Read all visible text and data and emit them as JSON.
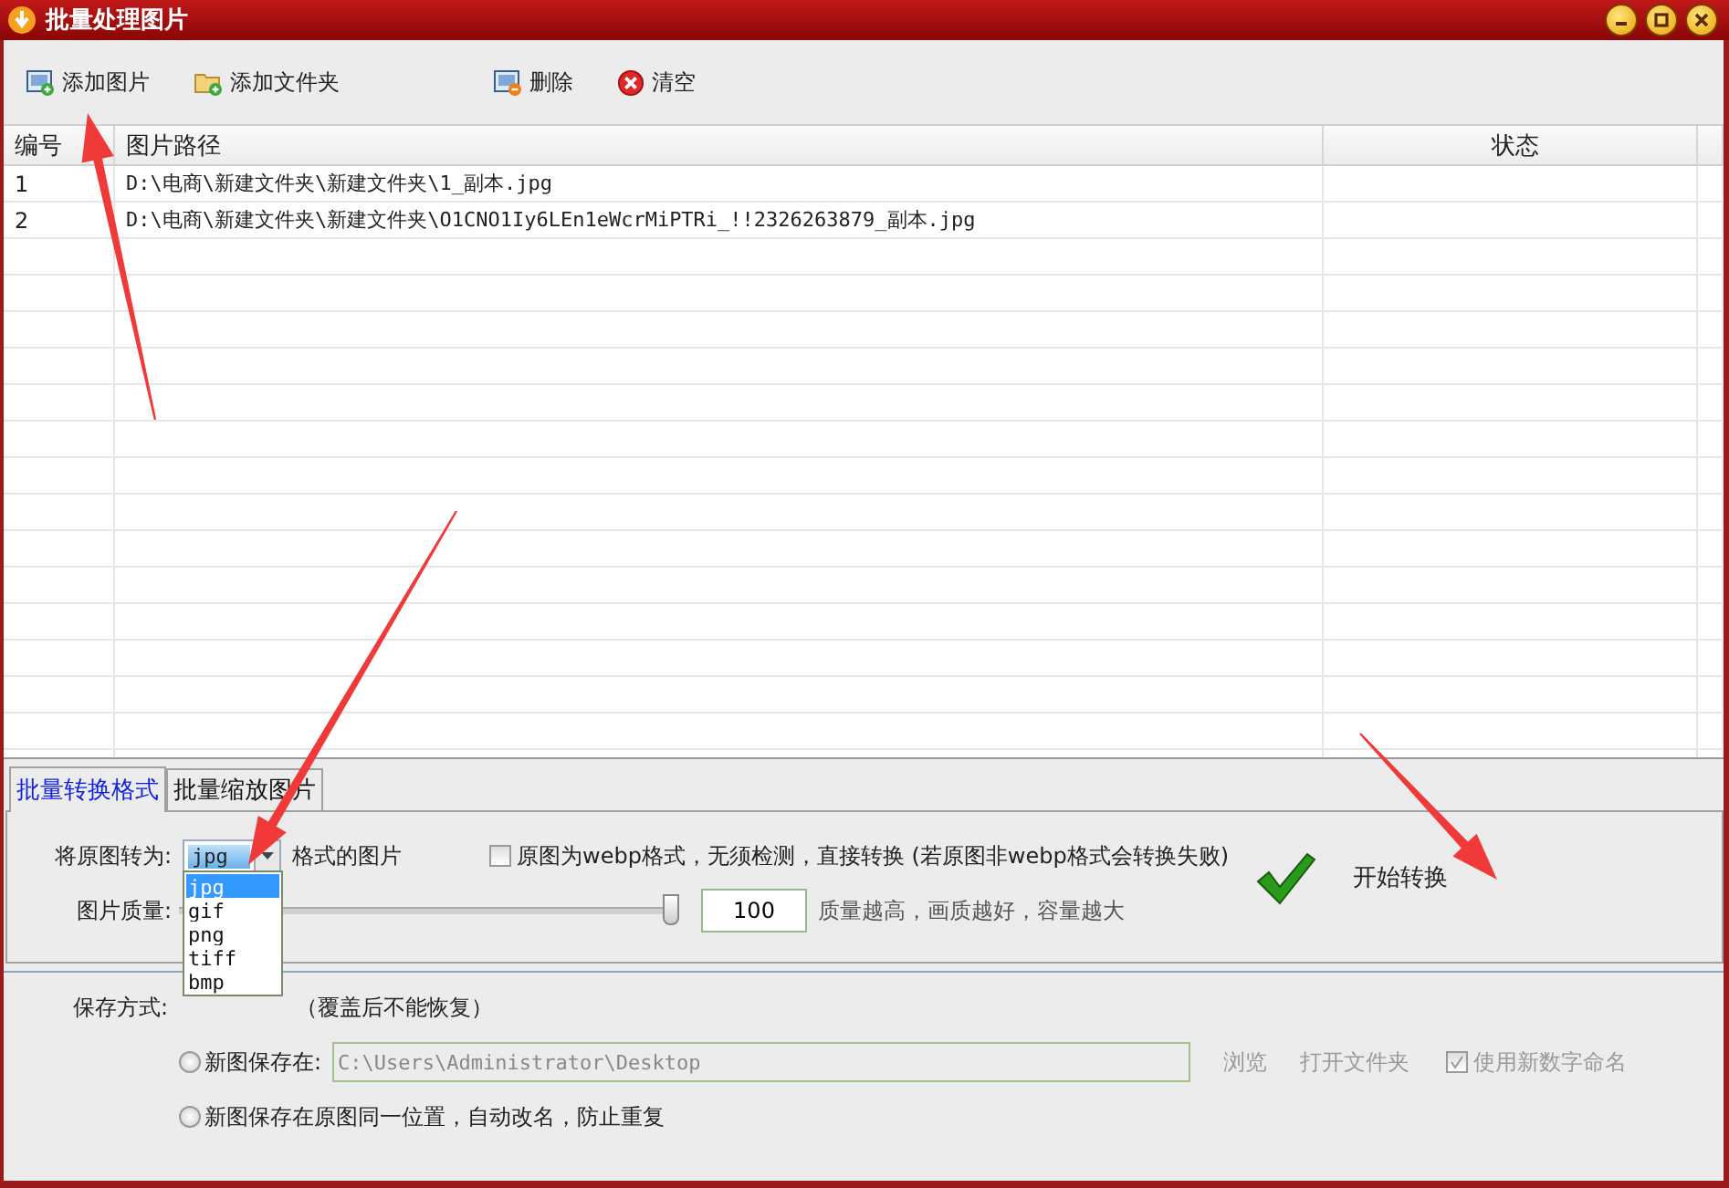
{
  "window": {
    "title": "批量处理图片"
  },
  "toolbar": [
    {
      "kind": "add-image",
      "label": "添加图片"
    },
    {
      "kind": "add-folder",
      "label": "添加文件夹"
    },
    {
      "kind": "delete",
      "label": "删除"
    },
    {
      "kind": "clear",
      "label": "清空"
    }
  ],
  "table": {
    "columns": [
      "编号",
      "图片路径",
      "状态"
    ],
    "rows": [
      {
        "index": "1",
        "path": "D:\\电商\\新建文件夹\\新建文件夹\\1_副本.jpg",
        "status": ""
      },
      {
        "index": "2",
        "path": "D:\\电商\\新建文件夹\\新建文件夹\\O1CNO1Iy6LEn1eWcrMiPTRi_!!2326263879_副本.jpg",
        "status": ""
      }
    ]
  },
  "tabs": [
    {
      "label": "批量转换格式",
      "selected": true
    },
    {
      "label": "批量缩放图片",
      "selected": false
    }
  ],
  "convert": {
    "label": "将原图转为:",
    "format": {
      "value": "jpg",
      "expanded": true,
      "options": [
        {
          "label": "jpg",
          "selected": true
        },
        {
          "label": "gif",
          "selected": false
        },
        {
          "label": "png",
          "selected": false
        },
        {
          "label": "tiff",
          "selected": false
        },
        {
          "label": "bmp",
          "selected": false
        }
      ]
    },
    "suffix": "格式的图片",
    "webp": {
      "label": "原图为webp格式，无须检测，直接转换 (若原图非webp格式会转换失败)",
      "checked": false
    },
    "quality": {
      "label": "图片质量:",
      "level": 1.0,
      "value": "100",
      "hint": "质量越高，画质越好，容量越大"
    },
    "start_button": "开始转换"
  },
  "save": {
    "label": "保存方式:",
    "options": [
      {
        "label": "（覆盖后不能恢复）"
      },
      {
        "label": "新图保存在:",
        "selected": false
      },
      {
        "label": "新图保存在原图同一位置，自动改名，防止重复",
        "selected": false
      }
    ],
    "path": {
      "value": "C:\\Users\\Administrator\\Desktop",
      "disabled": true
    },
    "browse": {
      "label": "浏览",
      "disabled": true
    },
    "open_folder": {
      "label": "打开文件夹",
      "disabled": true
    },
    "numeric_names": {
      "label": "使用新数字命名",
      "checked": true,
      "disabled": true
    }
  },
  "annotations": [
    {
      "kind": "arrow"
    },
    {
      "kind": "arrow"
    },
    {
      "kind": "arrow"
    }
  ]
}
